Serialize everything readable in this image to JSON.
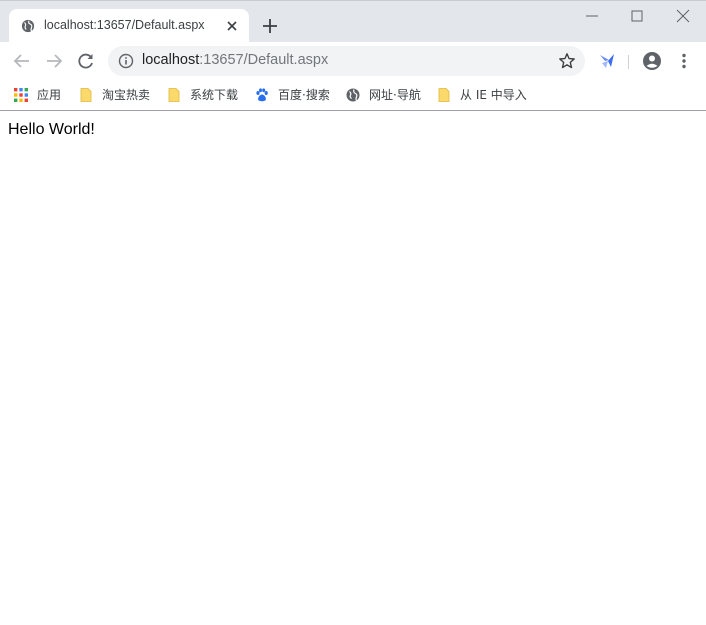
{
  "tab": {
    "title": "localhost:13657/Default.aspx"
  },
  "omnibox": {
    "host": "localhost",
    "path": ":13657/Default.aspx"
  },
  "bookmarks": [
    {
      "label": "应用",
      "icon": "apps-grid-icon"
    },
    {
      "label": "淘宝热卖",
      "icon": "folder-icon"
    },
    {
      "label": "系统下载",
      "icon": "folder-icon"
    },
    {
      "label": "百度·搜索",
      "icon": "baidu-paw-icon"
    },
    {
      "label": "网址·导航",
      "icon": "globe-icon"
    },
    {
      "label": "从 IE 中导入",
      "icon": "folder-icon"
    }
  ],
  "page": {
    "text": "Hello World!"
  },
  "colors": {
    "tabstrip": "#e3e6ea",
    "omnibox": "#f1f3f4",
    "folder": "#fbd96b",
    "baidu": "#2a6ff0"
  }
}
